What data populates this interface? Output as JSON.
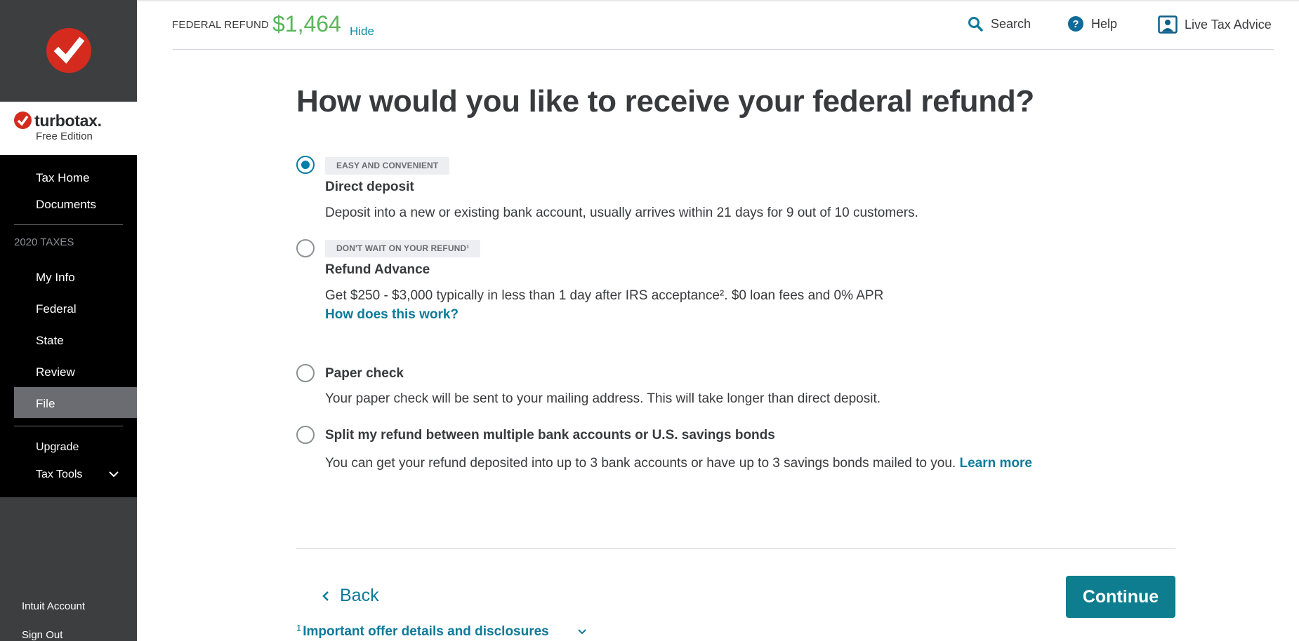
{
  "app": {
    "brand": "turbotax",
    "brand_suffix": ".",
    "edition": "Free Edition"
  },
  "sidebar": {
    "top_items": [
      "Tax Home",
      "Documents"
    ],
    "section_label": "2020 TAXES",
    "section_items": [
      "My Info",
      "Federal",
      "State",
      "Review",
      "File"
    ],
    "active_item": "File",
    "extra_items": [
      "Upgrade",
      "Tax Tools"
    ],
    "footer_items": [
      "Intuit Account",
      "Sign Out"
    ]
  },
  "header": {
    "refund_label": "FEDERAL REFUND",
    "refund_amount": "$1,464",
    "hide_label": "Hide",
    "search_label": "Search",
    "help_label": "Help",
    "advice_label": "Live Tax Advice"
  },
  "main": {
    "title": "How would you like to receive your federal refund?",
    "options": [
      {
        "badge": "EASY AND CONVENIENT",
        "title": "Direct deposit",
        "description": "Deposit into a new or existing bank account, usually arrives within 21 days for 9 out of 10 customers.",
        "selected": true
      },
      {
        "badge": "DON'T WAIT ON YOUR REFUND¹",
        "title": "Refund Advance",
        "description": "Get $250 - $3,000 typically in less than 1 day after IRS acceptance². $0 loan fees and 0% APR",
        "link": "How does this work?",
        "selected": false
      },
      {
        "title": "Paper check",
        "description": "Your paper check will be sent to your mailing address. This will take longer than direct deposit.",
        "selected": false
      },
      {
        "title": "Split my refund between multiple bank accounts or U.S. savings bonds",
        "description": "You can get your refund deposited into up to 3 bank accounts or have up to 3 savings bonds mailed to you.",
        "link": "Learn more",
        "selected": false
      }
    ]
  },
  "footer": {
    "back_label": "Back",
    "continue_label": "Continue",
    "disclosure_sup": "1",
    "disclosure_label": "Important offer details and disclosures"
  },
  "colors": {
    "refund_green": "#5bb55a",
    "link_teal": "#0e7a9a",
    "button_teal": "#0d7d8f",
    "brand_red": "#d52b1e",
    "sidebar_black": "#000000"
  },
  "icons": [
    "turbotax-check-icon",
    "search-icon",
    "help-icon",
    "live-advice-icon",
    "chevron-down-icon",
    "chevron-left-icon"
  ]
}
